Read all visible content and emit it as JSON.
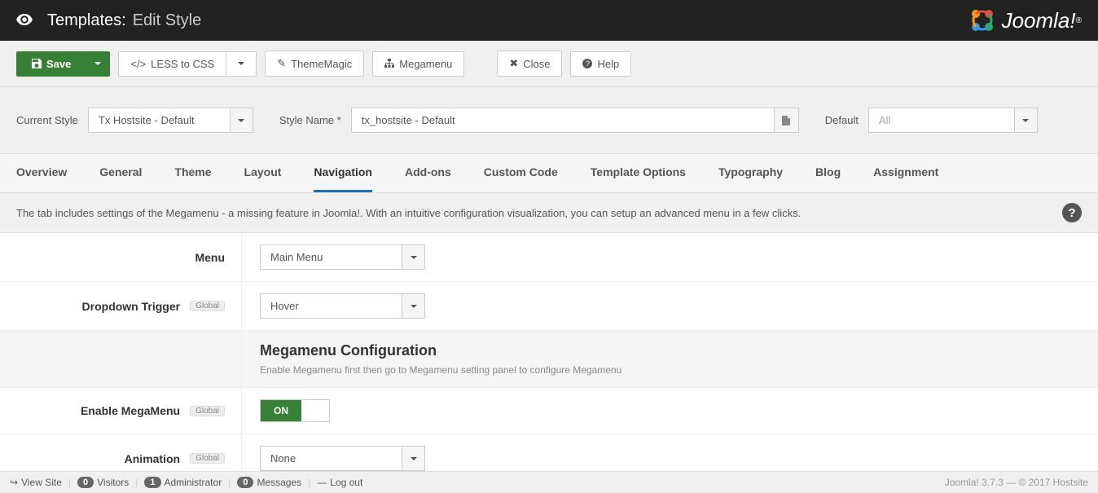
{
  "header": {
    "title": "Templates:",
    "subtitle": "Edit Style",
    "brand": "Joomla!"
  },
  "toolbar": {
    "save": "Save",
    "less_to_css": "LESS to CSS",
    "thememagic": "ThemeMagic",
    "megamenu": "Megamenu",
    "close": "Close",
    "help": "Help"
  },
  "formbar": {
    "current_style_label": "Current Style",
    "current_style_value": "Tx Hostsite - Default",
    "style_name_label": "Style Name *",
    "style_name_value": "tx_hostsite - Default",
    "default_label": "Default",
    "default_value": "All"
  },
  "tabs": {
    "items": [
      {
        "label": "Overview"
      },
      {
        "label": "General"
      },
      {
        "label": "Theme"
      },
      {
        "label": "Layout"
      },
      {
        "label": "Navigation",
        "active": true
      },
      {
        "label": "Add-ons"
      },
      {
        "label": "Custom Code"
      },
      {
        "label": "Template Options"
      },
      {
        "label": "Typography"
      },
      {
        "label": "Blog"
      },
      {
        "label": "Assignment"
      }
    ]
  },
  "description": "The tab includes settings of the Megamenu - a missing feature in Joomla!. With an intuitive configuration visualization, you can setup an advanced menu in a few clicks.",
  "settings": {
    "menu_label": "Menu",
    "menu_value": "Main Menu",
    "dropdown_trigger_label": "Dropdown Trigger",
    "dropdown_trigger_value": "Hover",
    "global_badge": "Global",
    "section_title": "Megamenu Configuration",
    "section_sub": "Enable Megamenu first then go to Megamenu setting panel to configure Megamenu",
    "enable_megamenu_label": "Enable MegaMenu",
    "toggle_on_text": "ON",
    "animation_label": "Animation",
    "animation_value": "None"
  },
  "footer": {
    "view_site": "View Site",
    "visitors_count": "0",
    "visitors_label": "Visitors",
    "admin_count": "1",
    "admin_label": "Administrator",
    "messages_count": "0",
    "messages_label": "Messages",
    "logout": "Log out",
    "version": "Joomla! 3.7.3",
    "copyright": "© 2017 Hostsite"
  }
}
